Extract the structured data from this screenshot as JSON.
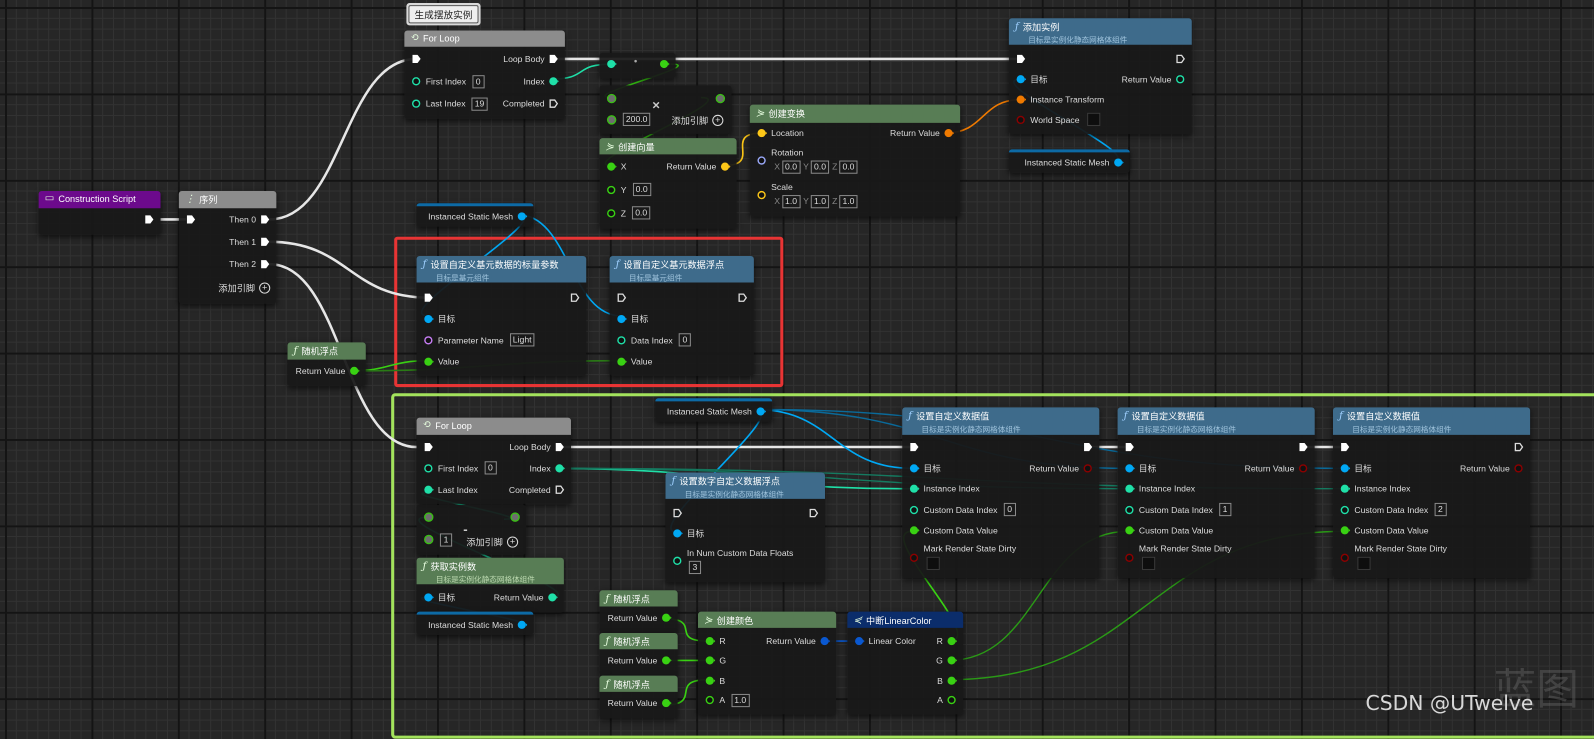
{
  "pin_colors": {
    "exec": "#ffffff",
    "float": "#39d113",
    "int": "#1fe0a8",
    "object": "#00a8f4",
    "vector": "#fdc718",
    "transform": "#f07a00",
    "bool": "#8c0000",
    "name": "#c77ef5",
    "struct": "#0a58d0",
    "wildcard": "#7a7a7a",
    "rotator": "#9aa8f8"
  },
  "header_colors": {
    "function": "#3e6b8b",
    "pure": "#587d55",
    "macro": "#8c8c8c",
    "event": "#6c0a8c",
    "struct": "#0b2d6b"
  },
  "frame_colors": {
    "highlight": "#e83434",
    "group": "#a3e35c"
  },
  "axes": [
    "X",
    "Y",
    "Z"
  ],
  "comment": {
    "title": "生成摆放实例"
  },
  "watermark": {
    "text": "CSDN @UTwelve",
    "logo": "蓝图"
  },
  "nodes": [
    {
      "id": "forloop_top",
      "kind": "macro",
      "icon": "loop",
      "title": "For Loop",
      "rows": [
        {
          "l": {
            "pin": "exec",
            "linked": true
          },
          "r": {
            "label": "Loop Body",
            "pin": "exec",
            "linked": true
          }
        },
        {
          "l": {
            "label": "First Index",
            "pin": "int",
            "val": "0"
          },
          "r": {
            "label": "Index",
            "pin": "int",
            "linked": true
          }
        },
        {
          "l": {
            "label": "Last Index",
            "pin": "int",
            "val": "19"
          },
          "r": {
            "label": "Completed",
            "pin": "exec"
          }
        }
      ]
    },
    {
      "id": "convert",
      "kind": "compact",
      "symbol": "•",
      "rows": [
        {
          "l": {
            "pin": "int",
            "linked": true
          },
          "r": {
            "pin": "float",
            "linked": true
          }
        }
      ]
    },
    {
      "id": "multiply",
      "kind": "compact",
      "symbol": "×",
      "add_pin": "添加引脚",
      "rows": [
        {
          "l": {
            "pin": "wildcard",
            "linked": true
          },
          "r": {
            "pin": "wildcard",
            "linked": true
          }
        },
        {
          "l": {
            "pin": "wildcard",
            "val": "200.0"
          }
        }
      ]
    },
    {
      "id": "make_vector",
      "kind": "pure",
      "icon": "make",
      "title": "创建向量",
      "rows": [
        {
          "l": {
            "label": "X",
            "pin": "float",
            "linked": true
          },
          "r": {
            "label": "Return Value",
            "pin": "vector",
            "linked": true
          }
        },
        {
          "l": {
            "label": "Y",
            "pin": "float",
            "val": "0.0"
          }
        },
        {
          "l": {
            "label": "Z",
            "pin": "float",
            "val": "0.0"
          }
        }
      ]
    },
    {
      "id": "make_transform",
      "kind": "pure",
      "icon": "make",
      "title": "创建变换",
      "rows": [
        {
          "l": {
            "label": "Location",
            "pin": "vector",
            "linked": true
          },
          "r": {
            "label": "Return Value",
            "pin": "transform",
            "linked": true
          }
        },
        {
          "l": {
            "label": "Rotation",
            "pin": "rotator",
            "vec": [
              "0.0",
              "0.0",
              "0.0"
            ]
          }
        },
        {
          "l": {
            "label": "Scale",
            "pin": "vector",
            "vec": [
              "1.0",
              "1.0",
              "1.0"
            ]
          }
        }
      ]
    },
    {
      "id": "add_instance",
      "kind": "function",
      "icon": "function",
      "title": "添加实例",
      "subtitle": "目标是实例化静态网格体组件",
      "rows": [
        {
          "l": {
            "pin": "exec",
            "linked": true
          },
          "r": {
            "pin": "exec"
          }
        },
        {
          "l": {
            "label": "目标",
            "pin": "object",
            "linked": true
          },
          "r": {
            "label": "Return Value",
            "pin": "int"
          }
        },
        {
          "l": {
            "label": "Instance Transform",
            "pin": "transform",
            "linked": true
          }
        },
        {
          "l": {
            "label": "World Space",
            "pin": "bool",
            "checkbox": false
          }
        }
      ]
    },
    {
      "id": "ism_a",
      "kind": "variable",
      "rows": [
        {
          "r": {
            "label": "Instanced Static Mesh",
            "pin": "object",
            "linked": true
          }
        }
      ]
    },
    {
      "id": "construction",
      "kind": "event",
      "icon": "event",
      "title": "Construction Script",
      "rows": [
        {
          "r": {
            "pin": "exec",
            "linked": true
          }
        }
      ]
    },
    {
      "id": "sequence",
      "kind": "macro",
      "icon": "sequence",
      "title": "序列",
      "add_pin": "添加引脚",
      "rows": [
        {
          "l": {
            "pin": "exec",
            "linked": true
          },
          "r": {
            "label": "Then 0",
            "pin": "exec",
            "linked": true
          }
        },
        {
          "r": {
            "label": "Then 1",
            "pin": "exec",
            "linked": true
          }
        },
        {
          "r": {
            "label": "Then 2",
            "pin": "exec",
            "linked": true
          }
        }
      ]
    },
    {
      "id": "ism_b",
      "kind": "variable",
      "rows": [
        {
          "r": {
            "label": "Instanced Static Mesh",
            "pin": "object",
            "linked": true
          }
        }
      ]
    },
    {
      "id": "set_scalar",
      "kind": "function",
      "icon": "function",
      "title": "设置自定义基元数据的标量参数",
      "subtitle": "目标是基元组件",
      "rows": [
        {
          "l": {
            "pin": "exec",
            "linked": true
          },
          "r": {
            "pin": "exec"
          }
        },
        {
          "l": {
            "label": "目标",
            "pin": "object",
            "linked": true
          }
        },
        {
          "l": {
            "label": "Parameter Name",
            "pin": "name",
            "val": "Light"
          }
        },
        {
          "l": {
            "label": "Value",
            "pin": "float",
            "linked": true
          }
        }
      ]
    },
    {
      "id": "set_float",
      "kind": "function",
      "icon": "function",
      "title": "设置自定义基元数据浮点",
      "subtitle": "目标是基元组件",
      "rows": [
        {
          "l": {
            "pin": "exec"
          },
          "r": {
            "pin": "exec"
          }
        },
        {
          "l": {
            "label": "目标",
            "pin": "object",
            "linked": true
          }
        },
        {
          "l": {
            "label": "Data Index",
            "pin": "int",
            "val": "0"
          }
        },
        {
          "l": {
            "label": "Value",
            "pin": "float",
            "linked": true
          }
        }
      ]
    },
    {
      "id": "random_a",
      "kind": "pure",
      "icon": "function",
      "title": "随机浮点",
      "rows": [
        {
          "r": {
            "label": "Return Value",
            "pin": "float",
            "linked": true
          }
        }
      ]
    },
    {
      "id": "ism_c",
      "kind": "variable",
      "rows": [
        {
          "r": {
            "label": "Instanced Static Mesh",
            "pin": "object",
            "linked": true
          }
        }
      ]
    },
    {
      "id": "forloop_bottom",
      "kind": "macro",
      "icon": "loop",
      "title": "For Loop",
      "rows": [
        {
          "l": {
            "pin": "exec",
            "linked": true
          },
          "r": {
            "label": "Loop Body",
            "pin": "exec",
            "linked": true
          }
        },
        {
          "l": {
            "label": "First Index",
            "pin": "int",
            "val": "0"
          },
          "r": {
            "label": "Index",
            "pin": "int",
            "linked": true
          }
        },
        {
          "l": {
            "label": "Last Index",
            "pin": "int",
            "linked": true
          },
          "r": {
            "label": "Completed",
            "pin": "exec"
          }
        }
      ]
    },
    {
      "id": "subtract",
      "kind": "compact",
      "symbol": "-",
      "add_pin": "添加引脚",
      "rows": [
        {
          "l": {
            "pin": "wildcard",
            "linked": true
          },
          "r": {
            "pin": "wildcard",
            "linked": true
          }
        },
        {
          "l": {
            "pin": "wildcard",
            "val": "1"
          }
        }
      ]
    },
    {
      "id": "get_count",
      "kind": "pure",
      "icon": "function",
      "title": "获取实例数",
      "subtitle": "目标是实例化静态网格体组件",
      "rows": [
        {
          "l": {
            "label": "目标",
            "pin": "object",
            "linked": true
          },
          "r": {
            "label": "Return Value",
            "pin": "int",
            "linked": true
          }
        }
      ]
    },
    {
      "id": "ism_d",
      "kind": "variable",
      "rows": [
        {
          "r": {
            "label": "Instanced Static Mesh",
            "pin": "object",
            "linked": true
          }
        }
      ]
    },
    {
      "id": "set_num_floats",
      "kind": "function",
      "icon": "function",
      "title": "设置数字自定义数据浮点",
      "subtitle": "目标是实例化静态网格体组件",
      "rows": [
        {
          "l": {
            "pin": "exec"
          },
          "r": {
            "pin": "exec"
          }
        },
        {
          "l": {
            "label": "目标",
            "pin": "object",
            "linked": true
          }
        },
        {
          "l": {
            "label": "In Num Custom Data Floats",
            "pin": "int",
            "val": "3"
          }
        }
      ]
    },
    {
      "id": "set_cdv_0",
      "kind": "function",
      "icon": "function",
      "title": "设置自定义数据值",
      "subtitle": "目标是实例化静态网格体组件",
      "rows": [
        {
          "l": {
            "pin": "exec",
            "linked": true
          },
          "r": {
            "pin": "exec",
            "linked": true
          }
        },
        {
          "l": {
            "label": "目标",
            "pin": "object",
            "linked": true
          },
          "r": {
            "label": "Return Value",
            "pin": "bool"
          }
        },
        {
          "l": {
            "label": "Instance Index",
            "pin": "int",
            "linked": true
          }
        },
        {
          "l": {
            "label": "Custom Data Index",
            "pin": "int",
            "val": "0"
          }
        },
        {
          "l": {
            "label": "Custom Data Value",
            "pin": "float",
            "linked": true
          }
        },
        {
          "l": {
            "label": "Mark Render State Dirty",
            "pin": "bool",
            "checkbox": false
          }
        }
      ]
    },
    {
      "id": "set_cdv_1",
      "kind": "function",
      "icon": "function",
      "title": "设置自定义数据值",
      "subtitle": "目标是实例化静态网格体组件",
      "rows": [
        {
          "l": {
            "pin": "exec",
            "linked": true
          },
          "r": {
            "pin": "exec",
            "linked": true
          }
        },
        {
          "l": {
            "label": "目标",
            "pin": "object",
            "linked": true
          },
          "r": {
            "label": "Return Value",
            "pin": "bool"
          }
        },
        {
          "l": {
            "label": "Instance Index",
            "pin": "int",
            "linked": true
          }
        },
        {
          "l": {
            "label": "Custom Data Index",
            "pin": "int",
            "val": "1"
          }
        },
        {
          "l": {
            "label": "Custom Data Value",
            "pin": "float",
            "linked": true
          }
        },
        {
          "l": {
            "label": "Mark Render State Dirty",
            "pin": "bool",
            "checkbox": false
          }
        }
      ]
    },
    {
      "id": "set_cdv_2",
      "kind": "function",
      "icon": "function",
      "title": "设置自定义数据值",
      "subtitle": "目标是实例化静态网格体组件",
      "rows": [
        {
          "l": {
            "pin": "exec",
            "linked": true
          },
          "r": {
            "pin": "exec"
          }
        },
        {
          "l": {
            "label": "目标",
            "pin": "object",
            "linked": true
          },
          "r": {
            "label": "Return Value",
            "pin": "bool"
          }
        },
        {
          "l": {
            "label": "Instance Index",
            "pin": "int",
            "linked": true
          }
        },
        {
          "l": {
            "label": "Custom Data Index",
            "pin": "int",
            "val": "2"
          }
        },
        {
          "l": {
            "label": "Custom Data Value",
            "pin": "float",
            "linked": true
          }
        },
        {
          "l": {
            "label": "Mark Render State Dirty",
            "pin": "bool",
            "checkbox": false
          }
        }
      ]
    },
    {
      "id": "random_b",
      "kind": "pure",
      "icon": "function",
      "title": "随机浮点",
      "rows": [
        {
          "r": {
            "label": "Return Value",
            "pin": "float",
            "linked": true
          }
        }
      ]
    },
    {
      "id": "random_c",
      "kind": "pure",
      "icon": "function",
      "title": "随机浮点",
      "rows": [
        {
          "r": {
            "label": "Return Value",
            "pin": "float",
            "linked": true
          }
        }
      ]
    },
    {
      "id": "random_d",
      "kind": "pure",
      "icon": "function",
      "title": "随机浮点",
      "rows": [
        {
          "r": {
            "label": "Return Value",
            "pin": "float",
            "linked": true
          }
        }
      ]
    },
    {
      "id": "make_color",
      "kind": "pure",
      "icon": "make",
      "title": "创建颜色",
      "rows": [
        {
          "l": {
            "label": "R",
            "pin": "float",
            "linked": true
          },
          "r": {
            "label": "Return Value",
            "pin": "struct",
            "linked": true
          }
        },
        {
          "l": {
            "label": "G",
            "pin": "float",
            "linked": true
          }
        },
        {
          "l": {
            "label": "B",
            "pin": "float",
            "linked": true
          }
        },
        {
          "l": {
            "label": "A",
            "pin": "float",
            "val": "1.0"
          }
        }
      ]
    },
    {
      "id": "break_color",
      "kind": "struct",
      "icon": "break",
      "title": "中断LinearColor",
      "rows": [
        {
          "l": {
            "label": "Linear Color",
            "pin": "struct",
            "linked": true
          },
          "r": {
            "label": "R",
            "pin": "float",
            "linked": true
          }
        },
        {
          "r": {
            "label": "G",
            "pin": "float",
            "linked": true
          }
        },
        {
          "r": {
            "label": "B",
            "pin": "float",
            "linked": true
          }
        },
        {
          "r": {
            "label": "A",
            "pin": "float"
          }
        }
      ]
    }
  ]
}
